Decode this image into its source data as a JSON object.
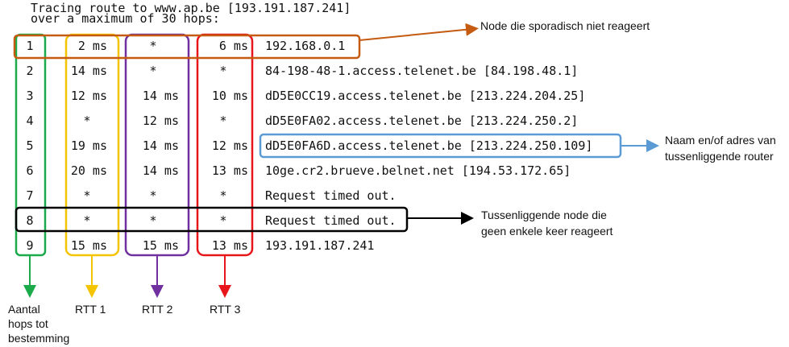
{
  "header": {
    "line1": "Tracing route to www.ap.be [193.191.187.241]",
    "line2": "over a maximum of 30 hops:"
  },
  "rows": [
    {
      "hop": "1",
      "rtt1": "2 ms",
      "rtt2": "*",
      "rtt3": "6 ms",
      "host": "192.168.0.1"
    },
    {
      "hop": "2",
      "rtt1": "14 ms",
      "rtt2": "*",
      "rtt3": "*",
      "host": "84-198-48-1.access.telenet.be [84.198.48.1]"
    },
    {
      "hop": "3",
      "rtt1": "12 ms",
      "rtt2": "14 ms",
      "rtt3": "10 ms",
      "host": "dD5E0CC19.access.telenet.be [213.224.204.25]"
    },
    {
      "hop": "4",
      "rtt1": "*",
      "rtt2": "12 ms",
      "rtt3": "*",
      "host": "dD5E0FA02.access.telenet.be [213.224.250.2]"
    },
    {
      "hop": "5",
      "rtt1": "19 ms",
      "rtt2": "14 ms",
      "rtt3": "12 ms",
      "host": "dD5E0FA6D.access.telenet.be [213.224.250.109]"
    },
    {
      "hop": "6",
      "rtt1": "20 ms",
      "rtt2": "14 ms",
      "rtt3": "13 ms",
      "host": "10ge.cr2.brueve.belnet.net [194.53.172.65]"
    },
    {
      "hop": "7",
      "rtt1": "*",
      "rtt2": "*",
      "rtt3": "*",
      "host": "Request timed out."
    },
    {
      "hop": "8",
      "rtt1": "*",
      "rtt2": "*",
      "rtt3": "*",
      "host": "Request timed out."
    },
    {
      "hop": "9",
      "rtt1": "15 ms",
      "rtt2": "15 ms",
      "rtt3": "13 ms",
      "host": "193.191.187.241"
    }
  ],
  "annotations": {
    "sporadic": "Node die sporadisch niet reageert",
    "router_line1": "Naam en/of adres van",
    "router_line2": "tussenliggende router",
    "never_line1": "Tussenliggende node die",
    "never_line2": "geen enkele keer reageert"
  },
  "column_labels": {
    "hops_line1": "Aantal",
    "hops_line2": "hops tot",
    "hops_line3": "bestemming",
    "rtt1": "RTT 1",
    "rtt2": "RTT 2",
    "rtt3": "RTT 3"
  },
  "colors": {
    "hops": "#1aaa4a",
    "rtt1": "#f5c400",
    "rtt2": "#7030a0",
    "rtt3": "#e8151b",
    "sporadic": "#c55a11",
    "router": "#5b9bd5",
    "never": "#000000"
  }
}
